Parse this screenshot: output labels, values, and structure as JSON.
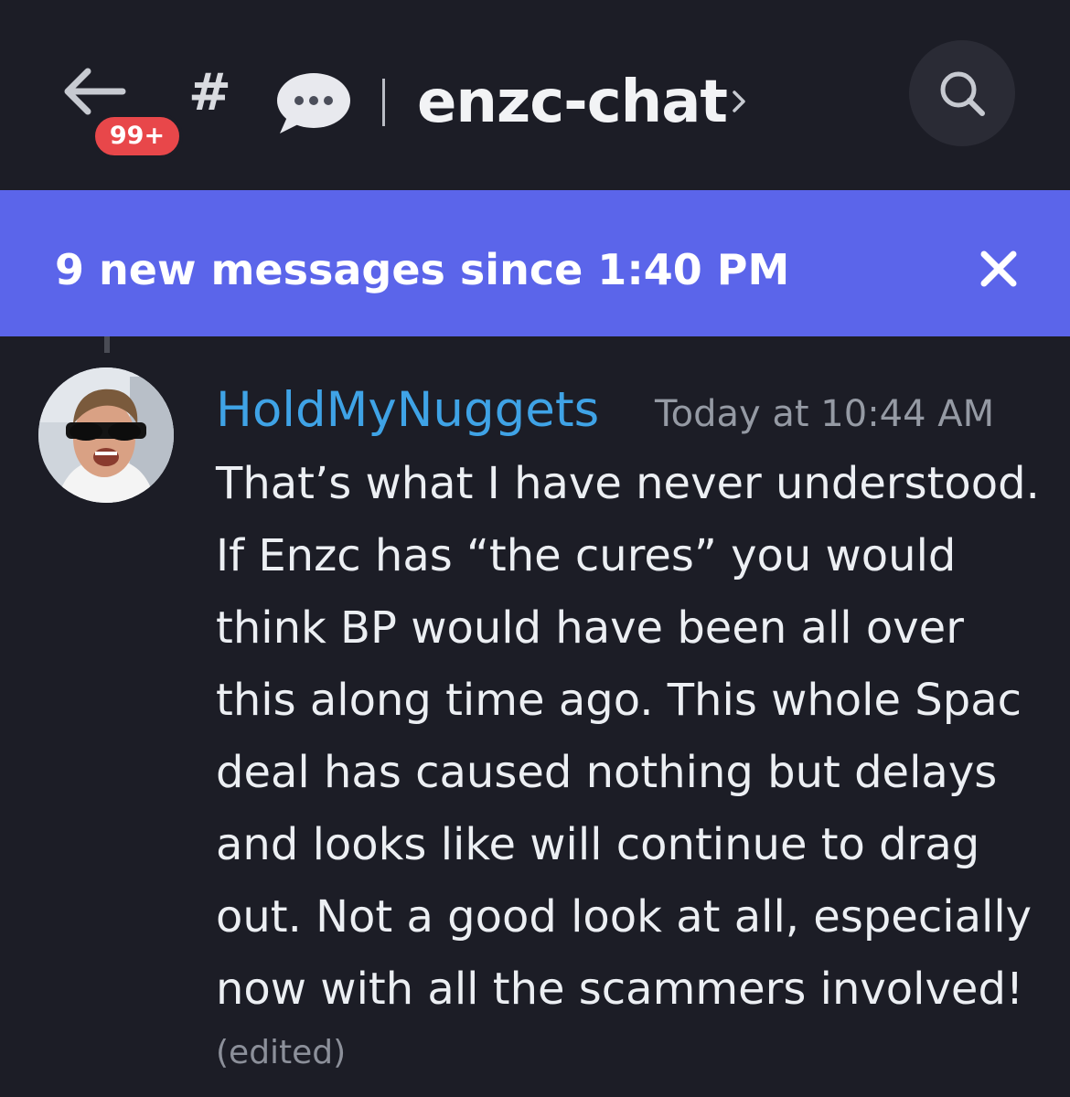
{
  "header": {
    "unread_badge": "99+",
    "channel_hash": "#",
    "channel_name": "enzc-chat",
    "icons": [
      "back-arrow-icon",
      "speech-bubble-icon",
      "chevron-right-icon",
      "search-icon"
    ]
  },
  "banner": {
    "text": "9 new messages since 1:40 PM",
    "close_icon": "close-icon"
  },
  "message": {
    "username": "HoldMyNuggets",
    "timestamp": "Today at 10:44 AM",
    "lines": [
      "That’s what I have never understood.",
      "If Enzc has “the cures” you would",
      "think BP would have been all over",
      "this along time ago. This whole Spac",
      "deal has caused nothing but delays",
      "and looks like will continue to drag",
      "out. Not a good look at all, especially",
      "now with all the scammers involved!"
    ],
    "edited": "(edited)"
  },
  "colors": {
    "background": "#1c1d26",
    "banner": "#5b65ea",
    "badge": "#e8474a",
    "username": "#3fa3e6"
  }
}
